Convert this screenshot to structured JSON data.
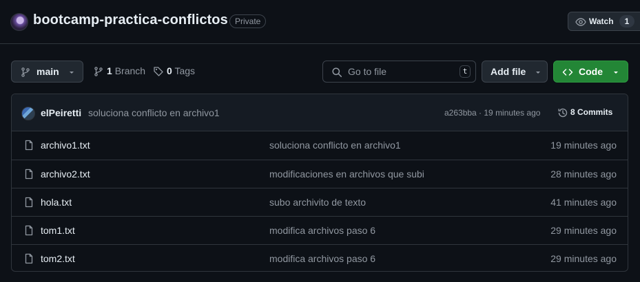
{
  "repo": {
    "name": "bootcamp-practica-conflictos",
    "visibility": "Private"
  },
  "watch": {
    "label": "Watch",
    "count": "1"
  },
  "toolbar": {
    "branch": "main",
    "branches_count": "1",
    "branches_label": "Branch",
    "tags_count": "0",
    "tags_label": "Tags",
    "search_placeholder": "Go to file",
    "search_shortcut": "t",
    "add_file_label": "Add file",
    "code_label": "Code"
  },
  "latest_commit": {
    "author": "elPeiretti",
    "message": "soluciona conflicto en archivo1",
    "meta": "a263bba · 19 minutes ago",
    "commits_label": "8 Commits"
  },
  "files": [
    {
      "name": "archivo1.txt",
      "message": "soluciona conflicto en archivo1",
      "date": "19 minutes ago"
    },
    {
      "name": "archivo2.txt",
      "message": "modificaciones en archivos que subi",
      "date": "28 minutes ago"
    },
    {
      "name": "hola.txt",
      "message": "subo archivito de texto",
      "date": "41 minutes ago"
    },
    {
      "name": "tom1.txt",
      "message": "modifica archivos paso 6",
      "date": "29 minutes ago"
    },
    {
      "name": "tom2.txt",
      "message": "modifica archivos paso 6",
      "date": "29 minutes ago"
    }
  ],
  "colors": {
    "background": "#0d1117",
    "border": "#30363d",
    "code_button": "#238636",
    "muted_text": "#9198a1"
  },
  "icons": [
    "repo-owner-avatar",
    "eye-icon",
    "git-branch-icon",
    "chevron-down-icon",
    "tag-icon",
    "search-icon",
    "code-icon",
    "history-icon",
    "file-icon"
  ]
}
